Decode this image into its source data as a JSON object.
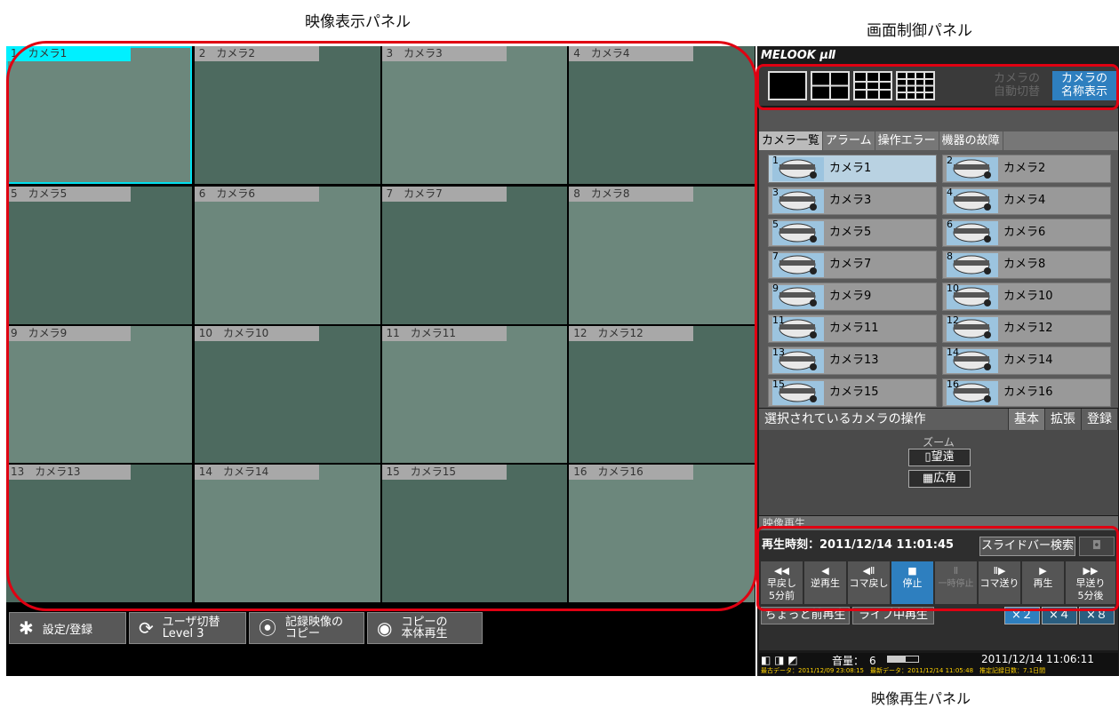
{
  "annotations": {
    "video_panel": "映像表示パネル",
    "screen_control_panel": "画面制御パネル",
    "playback_panel": "映像再生パネル"
  },
  "cells": [
    "1　カメラ1",
    "2　カメラ2",
    "3　カメラ3",
    "4　カメラ4",
    "5　カメラ5",
    "6　カメラ6",
    "7　カメラ7",
    "8　カメラ8",
    "9　カメラ9",
    "10　カメラ10",
    "11　カメラ11",
    "12　カメラ12",
    "13　カメラ13",
    "14　カメラ14",
    "15　カメラ15",
    "16　カメラ16"
  ],
  "bottom_buttons": {
    "settings": "設定/登録",
    "user_switch_1": "ユーザ切替",
    "user_switch_2": "Level 3",
    "copy_rec_1": "記録映像の",
    "copy_rec_2": "コピー",
    "play_copy_1": "コピーの",
    "play_copy_2": "本体再生"
  },
  "logo": "MELOOK μⅡ",
  "screen_control": {
    "auto_switch_1": "カメラの",
    "auto_switch_2": "自動切替",
    "name_display_1": "カメラの",
    "name_display_2": "名称表示"
  },
  "tabs": [
    "カメラ一覧",
    "アラーム",
    "操作エラー",
    "機器の故障"
  ],
  "cameras": [
    {
      "num": "1",
      "name": "カメラ1"
    },
    {
      "num": "2",
      "name": "カメラ2"
    },
    {
      "num": "3",
      "name": "カメラ3"
    },
    {
      "num": "4",
      "name": "カメラ4"
    },
    {
      "num": "5",
      "name": "カメラ5"
    },
    {
      "num": "6",
      "name": "カメラ6"
    },
    {
      "num": "7",
      "name": "カメラ7"
    },
    {
      "num": "8",
      "name": "カメラ8"
    },
    {
      "num": "9",
      "name": "カメラ9"
    },
    {
      "num": "10",
      "name": "カメラ10"
    },
    {
      "num": "11",
      "name": "カメラ11"
    },
    {
      "num": "12",
      "name": "カメラ12"
    },
    {
      "num": "13",
      "name": "カメラ13"
    },
    {
      "num": "14",
      "name": "カメラ14"
    },
    {
      "num": "15",
      "name": "カメラ15"
    },
    {
      "num": "16",
      "name": "カメラ16"
    }
  ],
  "operation": {
    "title": "選択されているカメラの操作",
    "tab_basic": "基本",
    "tab_ext": "拡張",
    "tab_reg": "登録",
    "zoom_label": "ズーム",
    "tele": "望遠",
    "wide": "広角"
  },
  "playback": {
    "section": "映像再生",
    "time_label": "再生時刻：2011/12/14 11:01:45",
    "slider_search": "スライドバー検索",
    "rewind_1": "早戻し",
    "rewind_2": "5分前",
    "reverse": "逆再生",
    "frame_back": "コマ戻し",
    "stop": "停止",
    "pause": "一時停止",
    "frame_fwd": "コマ送り",
    "play": "再生",
    "ff_1": "早送り",
    "ff_2": "5分後",
    "short_replay": "ちょっと前再生",
    "live_replay": "ライブ中再生",
    "speed_2": "×２",
    "speed_4": "×４",
    "speed_8": "×８"
  },
  "status": {
    "volume": "音量：　6",
    "clock": "2011/12/14 11:06:11",
    "info": "最古データ：2011/12/09 23:08:15　最新データ：2011/12/14 11:05:48　推定記録日数：7.1日間"
  }
}
